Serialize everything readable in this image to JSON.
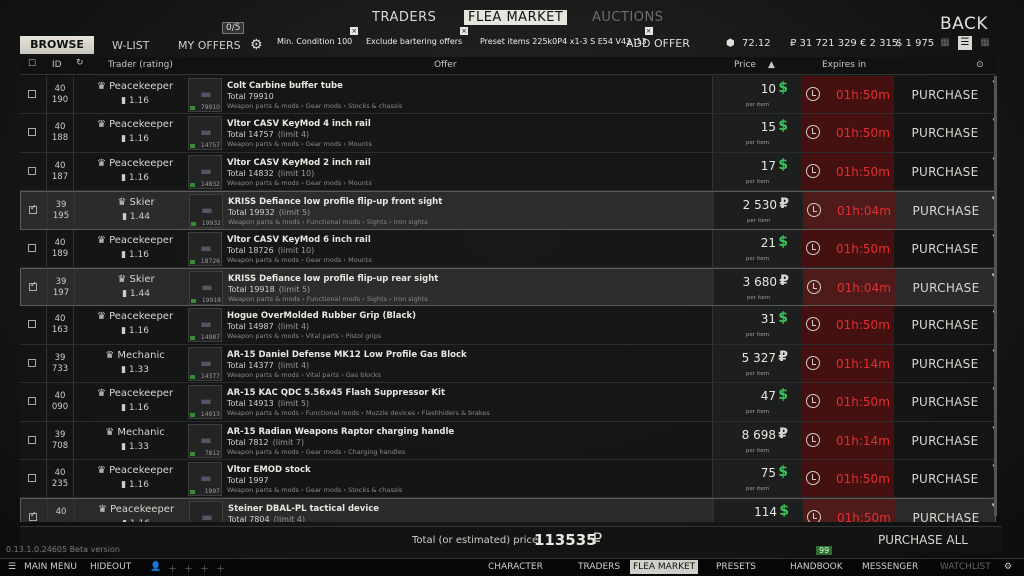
{
  "nav": {
    "traders": "TRADERS",
    "flea_market": "FLEA MARKET",
    "auctions": "AUCTIONS",
    "back": "BACK"
  },
  "subbar": {
    "browse": "BROWSE",
    "wlist": "W-LIST",
    "my_offers": "MY OFFERS",
    "offers_count": "0/5",
    "add_offer": "ADD OFFER"
  },
  "filters": [
    {
      "label": "Min. Condition 100"
    },
    {
      "label": "Exclude bartering offers"
    },
    {
      "label": "Preset items 225k0P4 x1-3 S E54 V43 \\13"
    }
  ],
  "currency": {
    "gp": "72.12",
    "rub": "₽ 31 721 329",
    "eur": "€ 2 315",
    "usd": "$ 1 975"
  },
  "columns": {
    "id": "ID",
    "trader": "Trader (rating)",
    "offer": "Offer",
    "price": "Price",
    "expires": "Expires in"
  },
  "per_item": "per item",
  "purchase": "PURCHASE",
  "rows": [
    {
      "selected": false,
      "id1": "40",
      "id2": "190",
      "trader": "Peacekeeper",
      "rating": "1.16",
      "thumb": "79910",
      "name": "Colt Carbine buffer tube",
      "total": "Total 79910",
      "limit": "",
      "cat": "Weapon parts & mods › Gear mods › Stocks & chassis",
      "price": "10",
      "cur": "$",
      "expires": "01h:50m"
    },
    {
      "selected": false,
      "id1": "40",
      "id2": "188",
      "trader": "Peacekeeper",
      "rating": "1.16",
      "thumb": "14757",
      "name": "Vltor CASV KeyMod 4 inch rail",
      "total": "Total 14757",
      "limit": "(limit 4)",
      "cat": "Weapon parts & mods › Gear mods › Mounts",
      "price": "15",
      "cur": "$",
      "expires": "01h:50m"
    },
    {
      "selected": false,
      "id1": "40",
      "id2": "187",
      "trader": "Peacekeeper",
      "rating": "1.16",
      "thumb": "14832",
      "name": "Vltor CASV KeyMod 2 inch rail",
      "total": "Total 14832",
      "limit": "(limit 10)",
      "cat": "Weapon parts & mods › Gear mods › Mounts",
      "price": "17",
      "cur": "$",
      "expires": "01h:50m"
    },
    {
      "selected": true,
      "id1": "39",
      "id2": "195",
      "trader": "Skier",
      "rating": "1.44",
      "thumb": "19932",
      "name": "KRISS Defiance low profile flip-up front sight",
      "total": "Total 19932",
      "limit": "(limit 5)",
      "cat": "Weapon parts & mods › Functional mods › Sights › Iron sights",
      "price": "2 530",
      "cur": "₽",
      "expires": "01h:04m"
    },
    {
      "selected": false,
      "id1": "40",
      "id2": "189",
      "trader": "Peacekeeper",
      "rating": "1.16",
      "thumb": "18726",
      "name": "Vltor CASV KeyMod 6 inch rail",
      "total": "Total 18726",
      "limit": "(limit 10)",
      "cat": "Weapon parts & mods › Gear mods › Mounts",
      "price": "21",
      "cur": "$",
      "expires": "01h:50m"
    },
    {
      "selected": true,
      "id1": "39",
      "id2": "197",
      "trader": "Skier",
      "rating": "1.44",
      "thumb": "19918",
      "name": "KRISS Defiance low profile flip-up rear sight",
      "total": "Total 19918",
      "limit": "(limit 5)",
      "cat": "Weapon parts & mods › Functional mods › Sights › Iron sights",
      "price": "3 680",
      "cur": "₽",
      "expires": "01h:04m"
    },
    {
      "selected": false,
      "id1": "40",
      "id2": "163",
      "trader": "Peacekeeper",
      "rating": "1.16",
      "thumb": "14987",
      "name": "Hogue OverMolded Rubber Grip (Black)",
      "total": "Total 14987",
      "limit": "(limit 4)",
      "cat": "Weapon parts & mods › Vital parts › Pistol grips",
      "price": "31",
      "cur": "$",
      "expires": "01h:50m"
    },
    {
      "selected": false,
      "id1": "39",
      "id2": "733",
      "trader": "Mechanic",
      "rating": "1.33",
      "thumb": "14377",
      "name": "AR-15 Daniel Defense MK12 Low Profile Gas Block",
      "total": "Total 14377",
      "limit": "(limit 4)",
      "cat": "Weapon parts & mods › Vital parts › Gas blocks",
      "price": "5 327",
      "cur": "₽",
      "expires": "01h:14m"
    },
    {
      "selected": false,
      "id1": "40",
      "id2": "090",
      "trader": "Peacekeeper",
      "rating": "1.16",
      "thumb": "14913",
      "name": "AR-15 KAC QDC 5.56x45 Flash Suppressor Kit",
      "total": "Total 14913",
      "limit": "(limit 5)",
      "cat": "Weapon parts & mods › Functional mods › Muzzle devices › Flashhiders & brakes",
      "price": "47",
      "cur": "$",
      "expires": "01h:50m"
    },
    {
      "selected": false,
      "id1": "39",
      "id2": "708",
      "trader": "Mechanic",
      "rating": "1.33",
      "thumb": "7812",
      "name": "AR-15 Radian Weapons Raptor charging handle",
      "total": "Total 7812",
      "limit": "(limit 7)",
      "cat": "Weapon parts & mods › Gear mods › Charging handles",
      "price": "8 698",
      "cur": "₽",
      "expires": "01h:14m"
    },
    {
      "selected": false,
      "id1": "40",
      "id2": "235",
      "trader": "Peacekeeper",
      "rating": "1.16",
      "thumb": "1997",
      "name": "Vltor EMOD stock",
      "total": "Total 1997",
      "limit": "",
      "cat": "Weapon parts & mods › Gear mods › Stocks & chassis",
      "price": "75",
      "cur": "$",
      "expires": "01h:50m"
    },
    {
      "selected": true,
      "id1": "40",
      "id2": "",
      "trader": "Peacekeeper",
      "rating": "1.16",
      "thumb": "7804",
      "name": "Steiner DBAL-PL tactical device",
      "total": "Total 7804",
      "limit": "(limit 4)",
      "cat": "",
      "price": "114",
      "cur": "$",
      "expires": "01h:50m"
    }
  ],
  "footer": {
    "label": "Total (or estimated) price:",
    "value": "113535",
    "cur": "₽",
    "purchase_all": "PURCHASE ALL"
  },
  "version": "0.13.1.0.24605 Beta version",
  "level": "99",
  "taskbar": {
    "main_menu": "MAIN MENU",
    "hideout": "HIDEOUT",
    "character": "CHARACTER",
    "traders": "TRADERS",
    "flea": "FLEA MARKET",
    "presets": "PRESETS",
    "handbook": "HANDBOOK",
    "messenger": "MESSENGER",
    "watchlist": "WATCHLIST"
  }
}
